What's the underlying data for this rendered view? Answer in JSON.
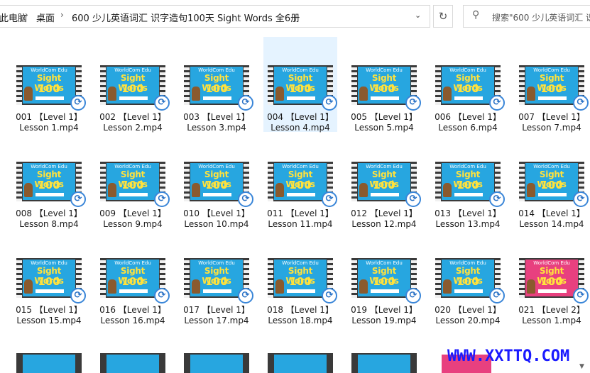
{
  "breadcrumb": {
    "items": [
      "此电脑",
      "桌面",
      "600 少儿英语词汇 识字造句100天 Sight Words 全6册"
    ],
    "separator": "›",
    "dropdown_icon": "chevron-down-icon"
  },
  "refresh_icon": "refresh-icon",
  "search": {
    "placeholder": "搜索\"600 少儿英语词汇 识"
  },
  "thumbnail": {
    "brand": "WorldCom Edu",
    "title": "Sight Words",
    "number": "100"
  },
  "files": [
    {
      "line1": "001 【Level 1】",
      "line2": "Lesson 1.mp4"
    },
    {
      "line1": "002 【Level 1】",
      "line2": "Lesson 2.mp4"
    },
    {
      "line1": "003 【Level 1】",
      "line2": "Lesson 3.mp4"
    },
    {
      "line1": "004 【Level 1】",
      "line2": "Lesson 4.mp4"
    },
    {
      "line1": "005 【Level 1】",
      "line2": "Lesson 5.mp4"
    },
    {
      "line1": "006 【Level 1】",
      "line2": "Lesson 6.mp4"
    },
    {
      "line1": "007 【Level 1】",
      "line2": "Lesson 7.mp4"
    },
    {
      "line1": "008 【Level 1】",
      "line2": "Lesson 8.mp4"
    },
    {
      "line1": "009 【Level 1】",
      "line2": "Lesson 9.mp4"
    },
    {
      "line1": "010 【Level 1】",
      "line2": "Lesson 10.mp4"
    },
    {
      "line1": "011 【Level 1】",
      "line2": "Lesson 11.mp4"
    },
    {
      "line1": "012 【Level 1】",
      "line2": "Lesson 12.mp4"
    },
    {
      "line1": "013 【Level 1】",
      "line2": "Lesson 13.mp4"
    },
    {
      "line1": "014 【Level 1】",
      "line2": "Lesson 14.mp4"
    },
    {
      "line1": "015 【Level 1】",
      "line2": "Lesson 15.mp4"
    },
    {
      "line1": "016 【Level 1】",
      "line2": "Lesson 16.mp4"
    },
    {
      "line1": "017 【Level 1】",
      "line2": "Lesson 17.mp4"
    },
    {
      "line1": "018 【Level 1】",
      "line2": "Lesson 18.mp4"
    },
    {
      "line1": "019 【Level 1】",
      "line2": "Lesson 19.mp4"
    },
    {
      "line1": "020 【Level 1】",
      "line2": "Lesson 20.mp4"
    },
    {
      "line1": "021 【Level 2】",
      "line2": "Lesson 1.mp4",
      "accent": "pink"
    }
  ],
  "selected_index": 3,
  "watermark": "WWW.XXTTQ.COM",
  "colors": {
    "selection": "#e5f3ff",
    "thumb_blue": "#27a6e0",
    "thumb_pink": "#e8407f",
    "watermark": "#1a1aff"
  }
}
